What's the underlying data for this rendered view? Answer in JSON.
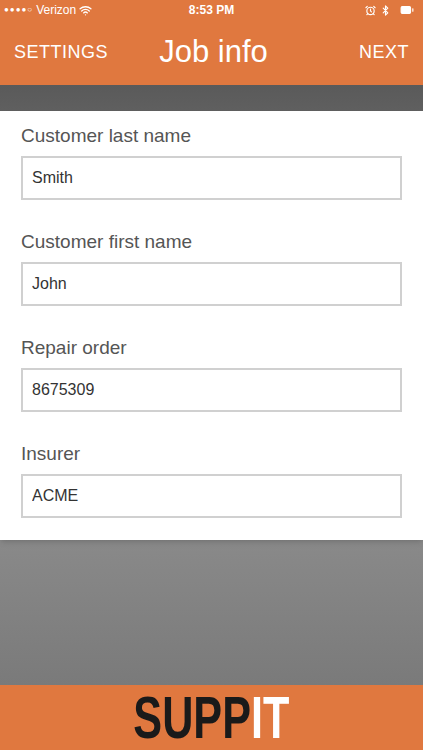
{
  "status_bar": {
    "signal": "●●●●○",
    "carrier": "Verizon",
    "time": "8:53 PM"
  },
  "nav": {
    "left": "SETTINGS",
    "title": "Job info",
    "right": "NEXT"
  },
  "fields": [
    {
      "label": "Customer last name",
      "value": "Smith"
    },
    {
      "label": "Customer first name",
      "value": "John"
    },
    {
      "label": "Repair order",
      "value": "8675309"
    },
    {
      "label": "Insurer",
      "value": "ACME"
    }
  ],
  "footer": {
    "logo": [
      {
        "text": "SUPP",
        "color": "#1a1a1a"
      },
      {
        "text": "IT",
        "color": "#ffffff"
      }
    ]
  }
}
